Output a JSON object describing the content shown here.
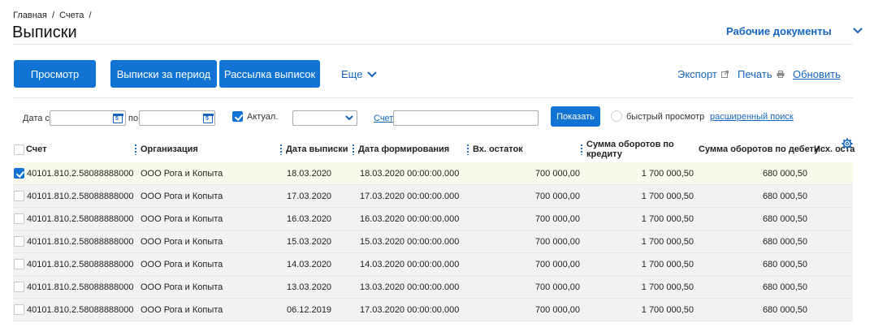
{
  "breadcrumb": [
    "Главная",
    "/",
    "Счета",
    "/"
  ],
  "page_title": "Выписки",
  "workdocs_label": "Рабочие документы",
  "toolbar": {
    "view_label": "Просмотр",
    "period_label": "Выписки за период",
    "mail_label": "Рассылка выписок",
    "more_label": "Еще",
    "export_label": "Экспорт",
    "print_label": "Печать",
    "refresh_label": "Обновить"
  },
  "filters": {
    "date_from_label": "Дата с",
    "date_from_value": "",
    "date_to_label": "по",
    "date_to_value": "",
    "actual_label": "Актуал.",
    "actual_checked": true,
    "status_select_value": "",
    "account_label": "Счет",
    "account_value": "",
    "show_label": "Показать",
    "quick_view_label": "быстрый просмотр",
    "advanced_search_label": "расширенный поиск"
  },
  "table": {
    "columns": [
      "Счет",
      "Организация",
      "Дата выписки",
      "Дата формирования",
      "Вх. остаток",
      "Сумма оборотов по кредиту",
      "Сумма оборотов по дебету",
      "Исх. оста"
    ],
    "rows": [
      {
        "checked": true,
        "account": "40101.810.2.58088888000",
        "org": "ООО Рога и Копыта",
        "stmt_date": "18.03.2020",
        "created": "18.03.2020 00:00:00.000",
        "opening": "700 000,00",
        "credit": "1 700 000,50",
        "debit": "680 000,50"
      },
      {
        "checked": false,
        "account": "40101.810.2.58088888000",
        "org": "ООО Рога и Копыта",
        "stmt_date": "17.03.2020",
        "created": "17.03.2020 00:00:00.000",
        "opening": "700 000,00",
        "credit": "1 700 000,50",
        "debit": "680 000,50"
      },
      {
        "checked": false,
        "account": "40101.810.2.58088888000",
        "org": "ООО Рога и Копыта",
        "stmt_date": "16.03.2020",
        "created": "16.03.2020 00:00:00.000",
        "opening": "700 000,00",
        "credit": "1 700 000,50",
        "debit": "680 000,50"
      },
      {
        "checked": false,
        "account": "40101.810.2.58088888000",
        "org": "ООО Рога и Копыта",
        "stmt_date": "15.03.2020",
        "created": "15.03.2020 00:00:00.000",
        "opening": "700 000,00",
        "credit": "1 700 000,50",
        "debit": "680 000,50"
      },
      {
        "checked": false,
        "account": "40101.810.2.58088888000",
        "org": "ООО Рога и Копыта",
        "stmt_date": "14.03.2020",
        "created": "14.03.2020 00:00:00.000",
        "opening": "700 000,00",
        "credit": "1 700 000,50",
        "debit": "680 000,50"
      },
      {
        "checked": false,
        "account": "40101.810.2.58088888000",
        "org": "ООО Рога и Копыта",
        "stmt_date": "13.03.2020",
        "created": "13.03.2020 00:00:00.000",
        "opening": "700 000,00",
        "credit": "1 700 000,50",
        "debit": "680 000,50"
      },
      {
        "checked": false,
        "account": "40101.810.2.58088888000",
        "org": "ООО Рога и Копыта",
        "stmt_date": "06.12.2019",
        "created": "17.03.2020 00:00:00.000",
        "opening": "700 000,00",
        "credit": "1 700 000,50",
        "debit": "680 000,50"
      }
    ]
  },
  "colors": {
    "accent": "#1173d4",
    "link": "#1565c0",
    "row_alt": "#f2f2f2",
    "row_selected": "#fafaea"
  },
  "icons": {
    "more": "chevron-down-icon",
    "workdocs": "chevron-down-icon",
    "export": "external-link-icon",
    "print": "printer-icon",
    "calendar": "calendar-icon",
    "settings": "gear-icon"
  }
}
